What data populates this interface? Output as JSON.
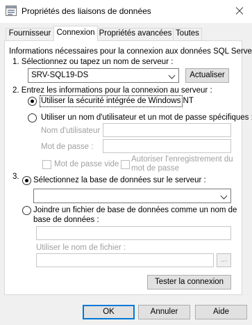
{
  "window": {
    "title": "Propriétés des liaisons de données"
  },
  "tabs": [
    "Fournisseur",
    "Connexion",
    "Propriétés avancées",
    "Toutes"
  ],
  "connection": {
    "intro": "Informations nécessaires pour la connexion aux données SQL Server :",
    "step1_label": "1. Sélectionnez ou tapez un nom de serveur :",
    "server_value": "SRV-SQL19-DS",
    "refresh_button": "Actualiser",
    "step2_label": "2. Entrez les informations pour la connexion au serveur :",
    "radio_integrated": "Utiliser la sécurité intégrée de Windows NT",
    "radio_user_password": "Utiliser un nom d'utilisateur et un mot de passe spécifiques :",
    "username_label": "Nom d'utilisateur :",
    "username_value": "",
    "password_label": "Mot de passe :",
    "password_value": "",
    "blank_password_label": "Mot de passe vide",
    "allow_save_password_line1": "Autoriser l'enregistrement du",
    "allow_save_password_line2": "mot de passe",
    "step3_number": "3.",
    "radio_select_db": "Sélectionnez la base de données sur le serveur :",
    "database_value": "",
    "radio_attach_file_line1": "Joindre un fichier de base de données comme un nom de",
    "radio_attach_file_line2": "base de données :",
    "attach_name_value": "",
    "filename_label": "Utiliser le nom de fichier :",
    "filename_value": "",
    "browse_button": "...",
    "test_button": "Tester la connexion"
  },
  "footer": {
    "ok": "OK",
    "cancel": "Annuler",
    "help": "Aide"
  }
}
